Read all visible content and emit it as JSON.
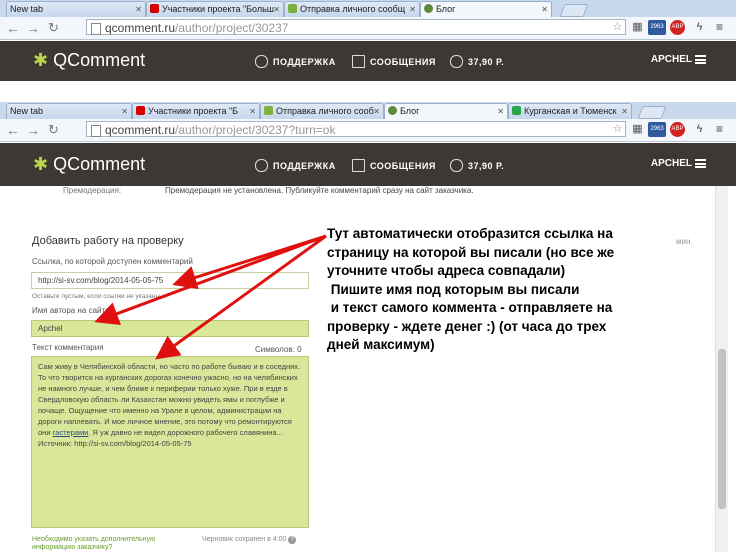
{
  "top_browser": {
    "tabs": [
      {
        "label": "New tab",
        "icon": "none"
      },
      {
        "label": "Участники проекта \"Больш",
        "icon": "youtube"
      },
      {
        "label": "Отправка личного сообщ",
        "icon": "page"
      },
      {
        "label": "Блог",
        "icon": "blog"
      }
    ],
    "url_main": "qcomment.ru",
    "url_path": "/author/project/30237",
    "badge": "2963",
    "abp": "ABP"
  },
  "site_header": {
    "logo": "QComment",
    "support": "ПОДДЕРЖКА",
    "messages": "СООБЩЕНИЯ",
    "balance": "37,90 Р.",
    "user": "APCHEL"
  },
  "bottom_browser": {
    "tabs": [
      {
        "label": "New tab",
        "icon": "none"
      },
      {
        "label": "Участники проекта \"Б",
        "icon": "youtube"
      },
      {
        "label": "Отправка личного сооб",
        "icon": "page"
      },
      {
        "label": "Блог",
        "icon": "blog"
      },
      {
        "label": "Курганская и Тюменск",
        "icon": "page"
      }
    ],
    "url_main": "qcomment.ru",
    "url_path": "/author/project/30237?turn=ok",
    "badge": "2963",
    "abp": "ABP"
  },
  "page": {
    "premod_label": "Премодерация:",
    "premod_text": "Премодерация не установлена. Публикуйте комментарий сразу на сайт заказчика.",
    "section_title": "Добавить работу на проверку",
    "link_label": "Ссылка, по которой доступен комментарий",
    "link_value": "http://si-sv.com/blog/2014-05-05-75",
    "link_hint": "Оставьте пустым, если ссылки не указаны",
    "author_label": "Имя автора на сайте",
    "author_value": "Apchel",
    "comment_label": "Текст комментария",
    "chars_label": "Символов: 0",
    "comment_text_before": "Сам живу в Челябинской области, но часто по работе бываю и в соседних. То что творится на курганских дорогах конечно ужасно, но на челябинских не намного лучше, и чем ближе к периферии только хуже. При в езде в Свердловскую область ли Казахстан можно увидеть ямы и поглубже и почаще. Ощущение что именно на Урале в целом, администрации на дороги наплевать. И мое личное мнение, это потому что ремонтируются они",
    "comment_text_link": "гастерами",
    "comment_text_after": ". Я уж давно не видел дорожного рабочего славянина... Источник: http://si-sv.com/blog/2014-05-05-75",
    "min_label": "мин.",
    "note_line1": "Необходимо указать дополнительную",
    "note_line2": "информацию заказчику?",
    "draft_text": "Черновик сохранен в 4:00"
  },
  "annotation": {
    "lines": [
      "Тут автоматически отобразится ссылка на",
      "страницу на которой вы писали (но все же",
      "уточните чтобы адреса совпадали)",
      " Пишите имя под которым вы писали",
      " и текст самого коммента - отправляете на",
      "проверку - ждете денег :) (от часа до трех",
      "дней максимум)"
    ]
  },
  "colors": {
    "header_bg": "#3d3834",
    "accent_green": "#b9d44d",
    "field_green": "#d8e79a",
    "arrow_red": "#e01010"
  }
}
